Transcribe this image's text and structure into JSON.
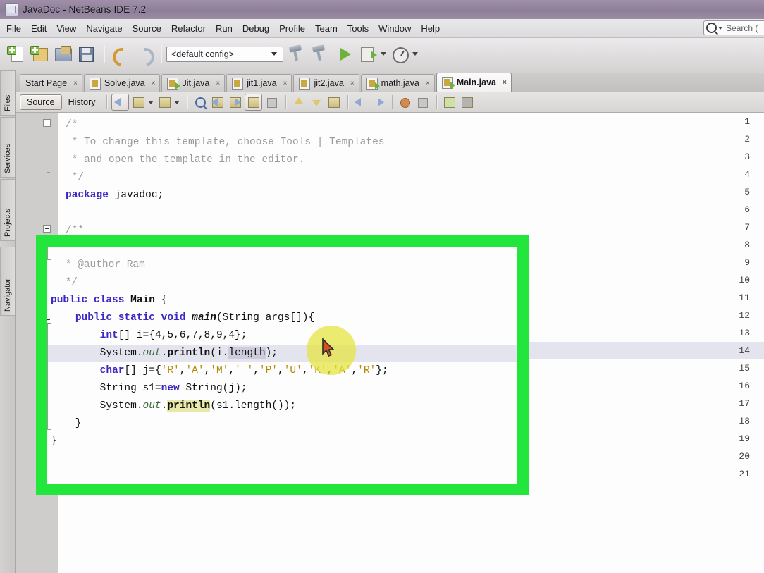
{
  "window": {
    "title": "JavaDoc - NetBeans IDE 7.2",
    "icon": "netbeans-icon"
  },
  "menubar": {
    "items": [
      {
        "label": "File",
        "name": "menu-file"
      },
      {
        "label": "Edit",
        "name": "menu-edit"
      },
      {
        "label": "View",
        "name": "menu-view"
      },
      {
        "label": "Navigate",
        "name": "menu-navigate"
      },
      {
        "label": "Source",
        "name": "menu-source"
      },
      {
        "label": "Refactor",
        "name": "menu-refactor"
      },
      {
        "label": "Run",
        "name": "menu-run"
      },
      {
        "label": "Debug",
        "name": "menu-debug"
      },
      {
        "label": "Profile",
        "name": "menu-profile"
      },
      {
        "label": "Team",
        "name": "menu-team"
      },
      {
        "label": "Tools",
        "name": "menu-tools"
      },
      {
        "label": "Window",
        "name": "menu-window"
      },
      {
        "label": "Help",
        "name": "menu-help"
      }
    ]
  },
  "search": {
    "placeholder": "Search (",
    "icon": "search-icon"
  },
  "toolbar": {
    "buttons": [
      {
        "name": "new-file-button",
        "icon": "new-file-icon"
      },
      {
        "name": "new-project-button",
        "icon": "new-project-icon"
      },
      {
        "name": "open-project-button",
        "icon": "open-project-icon"
      },
      {
        "name": "save-all-button",
        "icon": "save-all-icon"
      },
      {
        "name": "undo-button",
        "icon": "undo-icon"
      },
      {
        "name": "redo-button",
        "icon": "redo-icon"
      },
      {
        "name": "build-project-button",
        "icon": "hammer-icon"
      },
      {
        "name": "clean-build-button",
        "icon": "clean-build-icon"
      },
      {
        "name": "run-project-button",
        "icon": "play-icon"
      },
      {
        "name": "debug-project-button",
        "icon": "debug-icon"
      },
      {
        "name": "profile-project-button",
        "icon": "profile-icon"
      }
    ],
    "config_value": "<default config>"
  },
  "leftdock": {
    "tabs": [
      {
        "label": "Files",
        "name": "sidebar-tab-files",
        "icon": "files-icon"
      },
      {
        "label": "Services",
        "name": "sidebar-tab-services",
        "icon": "services-icon"
      },
      {
        "label": "Projects",
        "name": "sidebar-tab-projects",
        "icon": "projects-icon"
      },
      {
        "label": "Navigator",
        "name": "sidebar-tab-navigator",
        "icon": "navigator-icon"
      }
    ]
  },
  "editor_tabs": [
    {
      "label": "Start Page",
      "active": false,
      "icon": "none",
      "close": "×"
    },
    {
      "label": "Solve.java",
      "active": false,
      "icon": "java-file-icon",
      "close": "×"
    },
    {
      "label": "Jit.java",
      "active": false,
      "icon": "java-main-file-icon",
      "close": "×"
    },
    {
      "label": "jit1.java",
      "active": false,
      "icon": "java-file-icon",
      "close": "×"
    },
    {
      "label": "jit2.java",
      "active": false,
      "icon": "java-file-icon",
      "close": "×"
    },
    {
      "label": "math.java",
      "active": false,
      "icon": "java-main-file-icon",
      "close": "×"
    },
    {
      "label": "Main.java",
      "active": true,
      "icon": "java-main-file-icon",
      "close": "×"
    }
  ],
  "editor_toolbar": {
    "source_label": "Source",
    "history_label": "History",
    "buttons": [
      {
        "name": "last-edit-button",
        "icon": "last-edit-icon"
      },
      {
        "name": "back-button",
        "icon": "back-arrow-icon"
      },
      {
        "name": "forward-button",
        "icon": "forward-arrow-icon"
      },
      {
        "name": "find-selection-button",
        "icon": "find-selection-icon"
      },
      {
        "name": "find-previous-button",
        "icon": "find-previous-icon"
      },
      {
        "name": "find-next-button",
        "icon": "find-next-icon"
      },
      {
        "name": "toggle-highlight-button",
        "icon": "toggle-highlight-icon"
      },
      {
        "name": "toggle-rectangular-selection-button",
        "icon": "rect-selection-icon"
      },
      {
        "name": "previous-bookmark-button",
        "icon": "up-arrow-icon"
      },
      {
        "name": "next-bookmark-button",
        "icon": "down-arrow-icon"
      },
      {
        "name": "toggle-bookmark-button",
        "icon": "bookmark-icon"
      },
      {
        "name": "shift-left-button",
        "icon": "shift-left-icon"
      },
      {
        "name": "shift-right-button",
        "icon": "shift-right-icon"
      },
      {
        "name": "toggle-breakpoint-button",
        "icon": "breakpoint-icon"
      },
      {
        "name": "stop-button",
        "icon": "stop-icon"
      },
      {
        "name": "comment-button",
        "icon": "comment-icon"
      },
      {
        "name": "uncomment-button",
        "icon": "uncomment-icon"
      }
    ]
  },
  "code": {
    "first_line": 1,
    "last_line": 21,
    "current_line": 14,
    "lines": [
      {
        "n": 1,
        "text": "/*"
      },
      {
        "n": 2,
        "text": " * To change this template, choose Tools | Templates"
      },
      {
        "n": 3,
        "text": " * and open the template in the editor."
      },
      {
        "n": 4,
        "text": " */"
      },
      {
        "n": 5,
        "text": "package javadoc;"
      },
      {
        "n": 6,
        "text": ""
      },
      {
        "n": 7,
        "text": "/**"
      },
      {
        "n": 8,
        "text": " *"
      },
      {
        "n": 9,
        "text": " * @author Ram"
      },
      {
        "n": 10,
        "text": " */"
      },
      {
        "n": 11,
        "text": "public class Main {"
      },
      {
        "n": 12,
        "text": "    public static void main(String args[]){"
      },
      {
        "n": 13,
        "text": "        int[] i={4,5,6,7,8,9,4};"
      },
      {
        "n": 14,
        "text": "        System.out.println(i.length);"
      },
      {
        "n": 15,
        "text": "        char[] j={'R','A','M',' ','P','U','K','A','R'};"
      },
      {
        "n": 16,
        "text": "        String s1=new String(j);"
      },
      {
        "n": 17,
        "text": "        System.out.println(s1.length());"
      },
      {
        "n": 18,
        "text": "    }"
      },
      {
        "n": 19,
        "text": "}"
      },
      {
        "n": 20,
        "text": ""
      },
      {
        "n": 21,
        "text": ""
      }
    ]
  },
  "annotation": {
    "highlight_box_color": "#22e63c",
    "cursor_glow_color": "#e3e33c",
    "cursor_icon": "mouse-cursor-icon"
  }
}
